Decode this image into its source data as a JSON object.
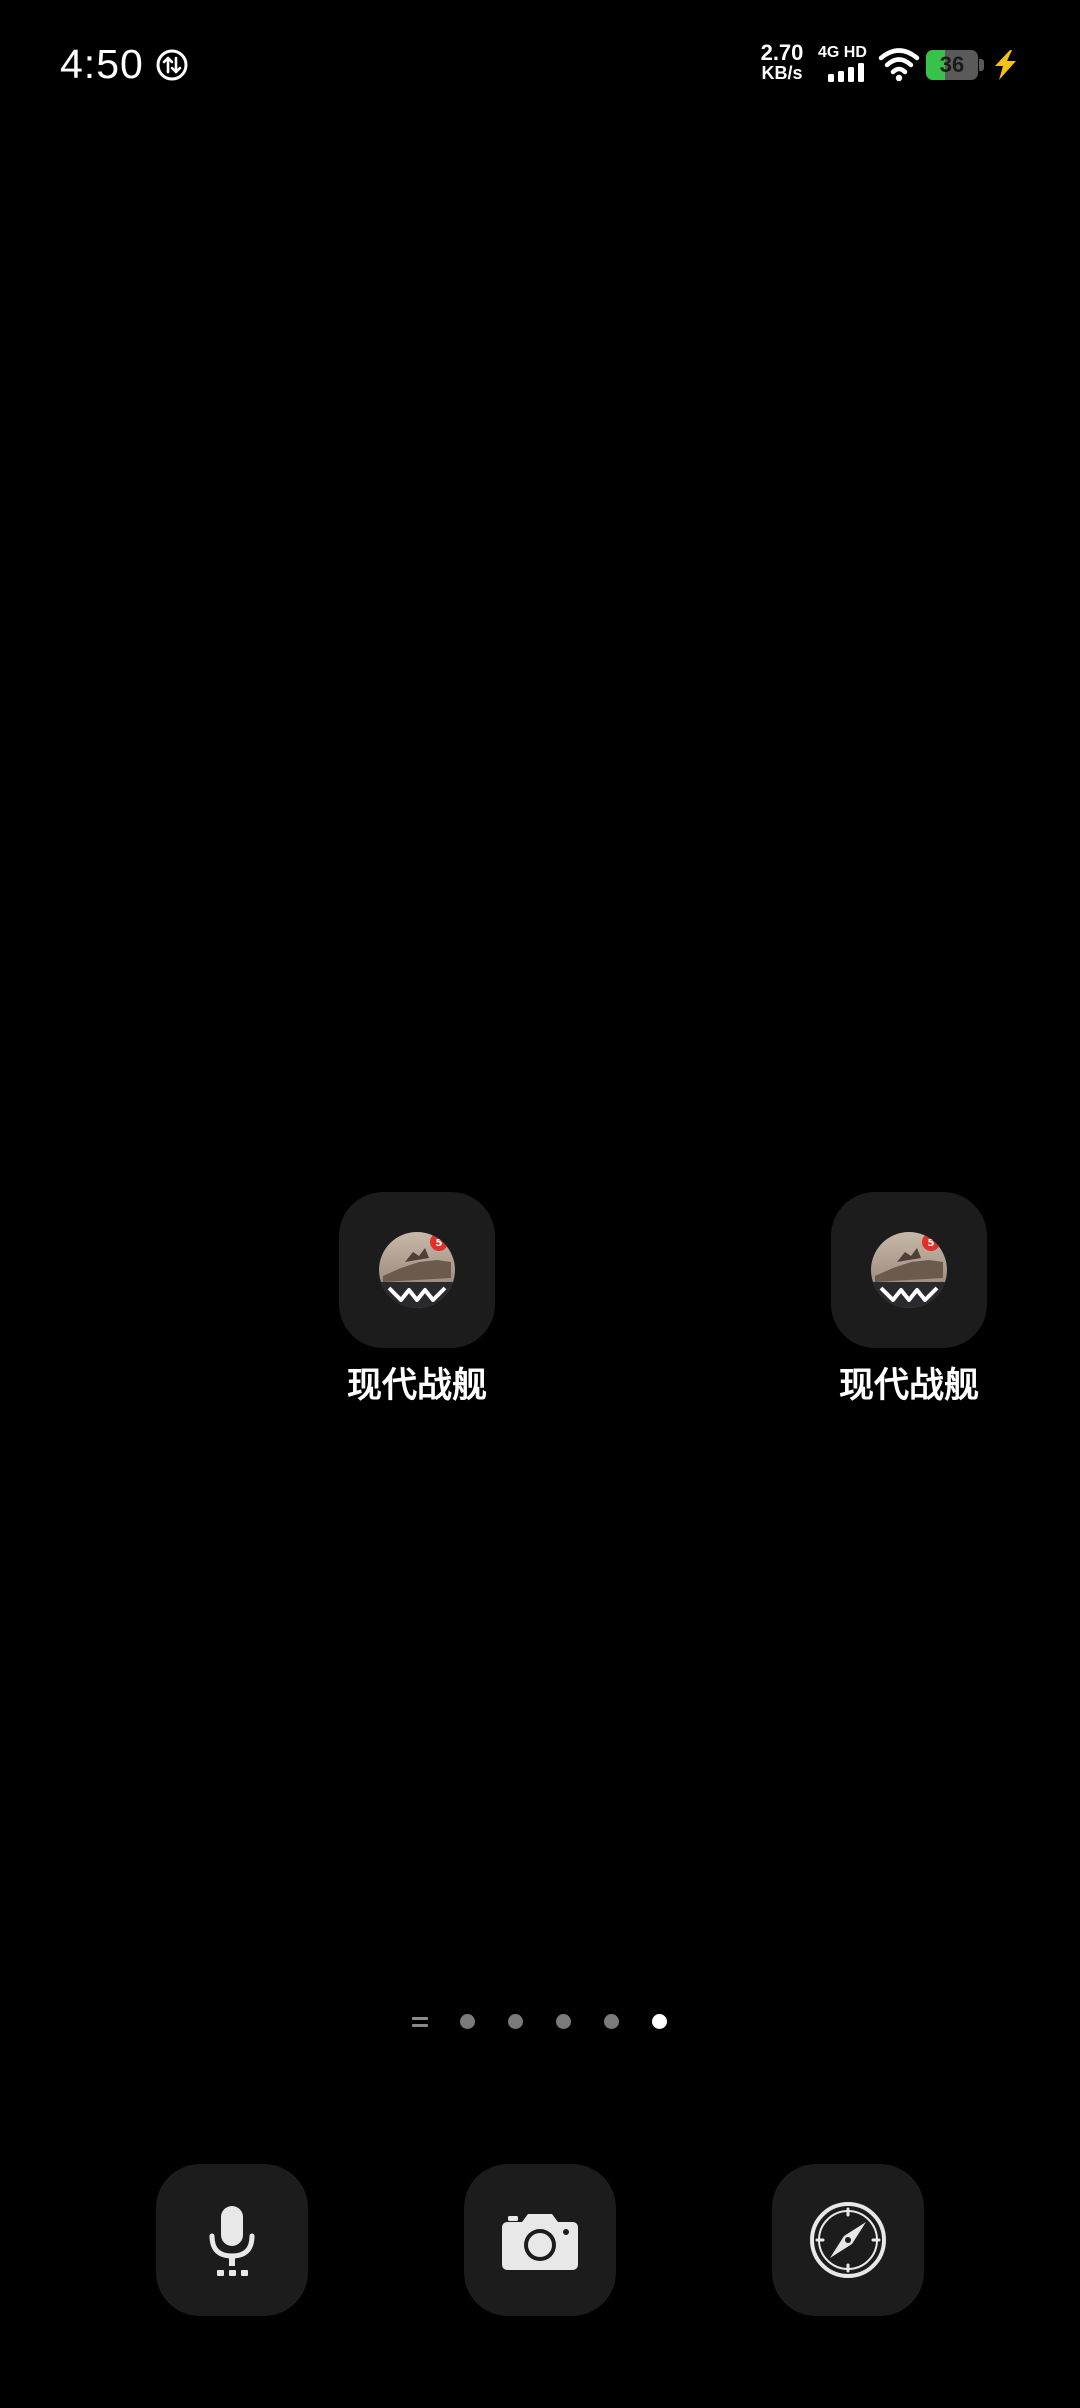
{
  "status_bar": {
    "time": "4:50",
    "net_speed_value": "2.70",
    "net_speed_unit": "KB/s",
    "network_type": "4G HD",
    "battery_percent": "36",
    "battery_level": 0.36,
    "icons": [
      "data-saver-icon",
      "signal-icon",
      "wifi-icon",
      "battery-icon",
      "charging-icon"
    ]
  },
  "apps": [
    {
      "label": "现代战舰",
      "icon": "modern-warships-app-icon"
    },
    {
      "label": "现代战舰",
      "icon": "modern-warships-app-icon"
    }
  ],
  "page_indicator": {
    "pages": 5,
    "active_page": 5
  },
  "dock": {
    "items": [
      {
        "icon": "microphone-icon"
      },
      {
        "icon": "camera-icon"
      },
      {
        "icon": "compass-icon"
      }
    ]
  },
  "colors": {
    "background": "#000000",
    "tile": "#1c1c1c",
    "battery_green": "#39c24a",
    "charging_yellow": "#f2c21b"
  }
}
